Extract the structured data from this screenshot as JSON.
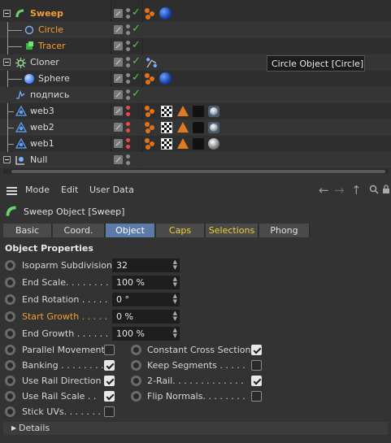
{
  "objects": [
    {
      "name": "Sweep",
      "color": "orange"
    },
    {
      "name": "Circle",
      "color": "orange"
    },
    {
      "name": "Tracer",
      "color": "orange"
    },
    {
      "name": "Cloner",
      "color": "white"
    },
    {
      "name": "Sphere",
      "color": "white"
    },
    {
      "name": "подпись",
      "color": "white"
    },
    {
      "name": "web3",
      "color": "white"
    },
    {
      "name": "web2",
      "color": "white"
    },
    {
      "name": "web1",
      "color": "white"
    },
    {
      "name": "Null",
      "color": "white"
    }
  ],
  "tooltip": "Circle Object [Circle]",
  "menu": {
    "mode": "Mode",
    "edit": "Edit",
    "user_data": "User Data"
  },
  "am_title": "Sweep Object [Sweep]",
  "tabs": [
    "Basic",
    "Coord.",
    "Object",
    "Caps",
    "Selections",
    "Phong"
  ],
  "active_tab": "Object",
  "section_title": "Object Properties",
  "fields": [
    {
      "label": "Isoparm Subdivision",
      "value": "32"
    },
    {
      "label": "End Scale. . . . . . . .",
      "value": "100 %"
    },
    {
      "label": "End Rotation  . . . . .",
      "value": "0 °"
    },
    {
      "label": "Start Growth  . . . . .",
      "value": "0 %"
    },
    {
      "label": "End Growth  . . . . . .",
      "value": "100 %"
    }
  ],
  "checks_left": [
    {
      "label": "Parallel Movement",
      "checked": false
    },
    {
      "label": "Banking . . . . . . . .",
      "checked": true
    },
    {
      "label": "Use Rail Direction",
      "checked": true
    },
    {
      "label": "Use Rail Scale  . .",
      "checked": true
    },
    {
      "label": "Stick UVs. . . . . . .",
      "checked": false
    }
  ],
  "checks_right": [
    {
      "label": "Constant Cross Section",
      "checked": true
    },
    {
      "label": "Keep Segments  . . . . .",
      "checked": false
    },
    {
      "label": "2-Rail. . . . . . . . . . . . .",
      "checked": true
    },
    {
      "label": "Flip Normals. . . . . . . .",
      "checked": false
    }
  ],
  "details": "Details",
  "colors": {
    "accent": "#5b7ca8",
    "orange": "#f0a030",
    "check_green": "#4bd04b"
  }
}
